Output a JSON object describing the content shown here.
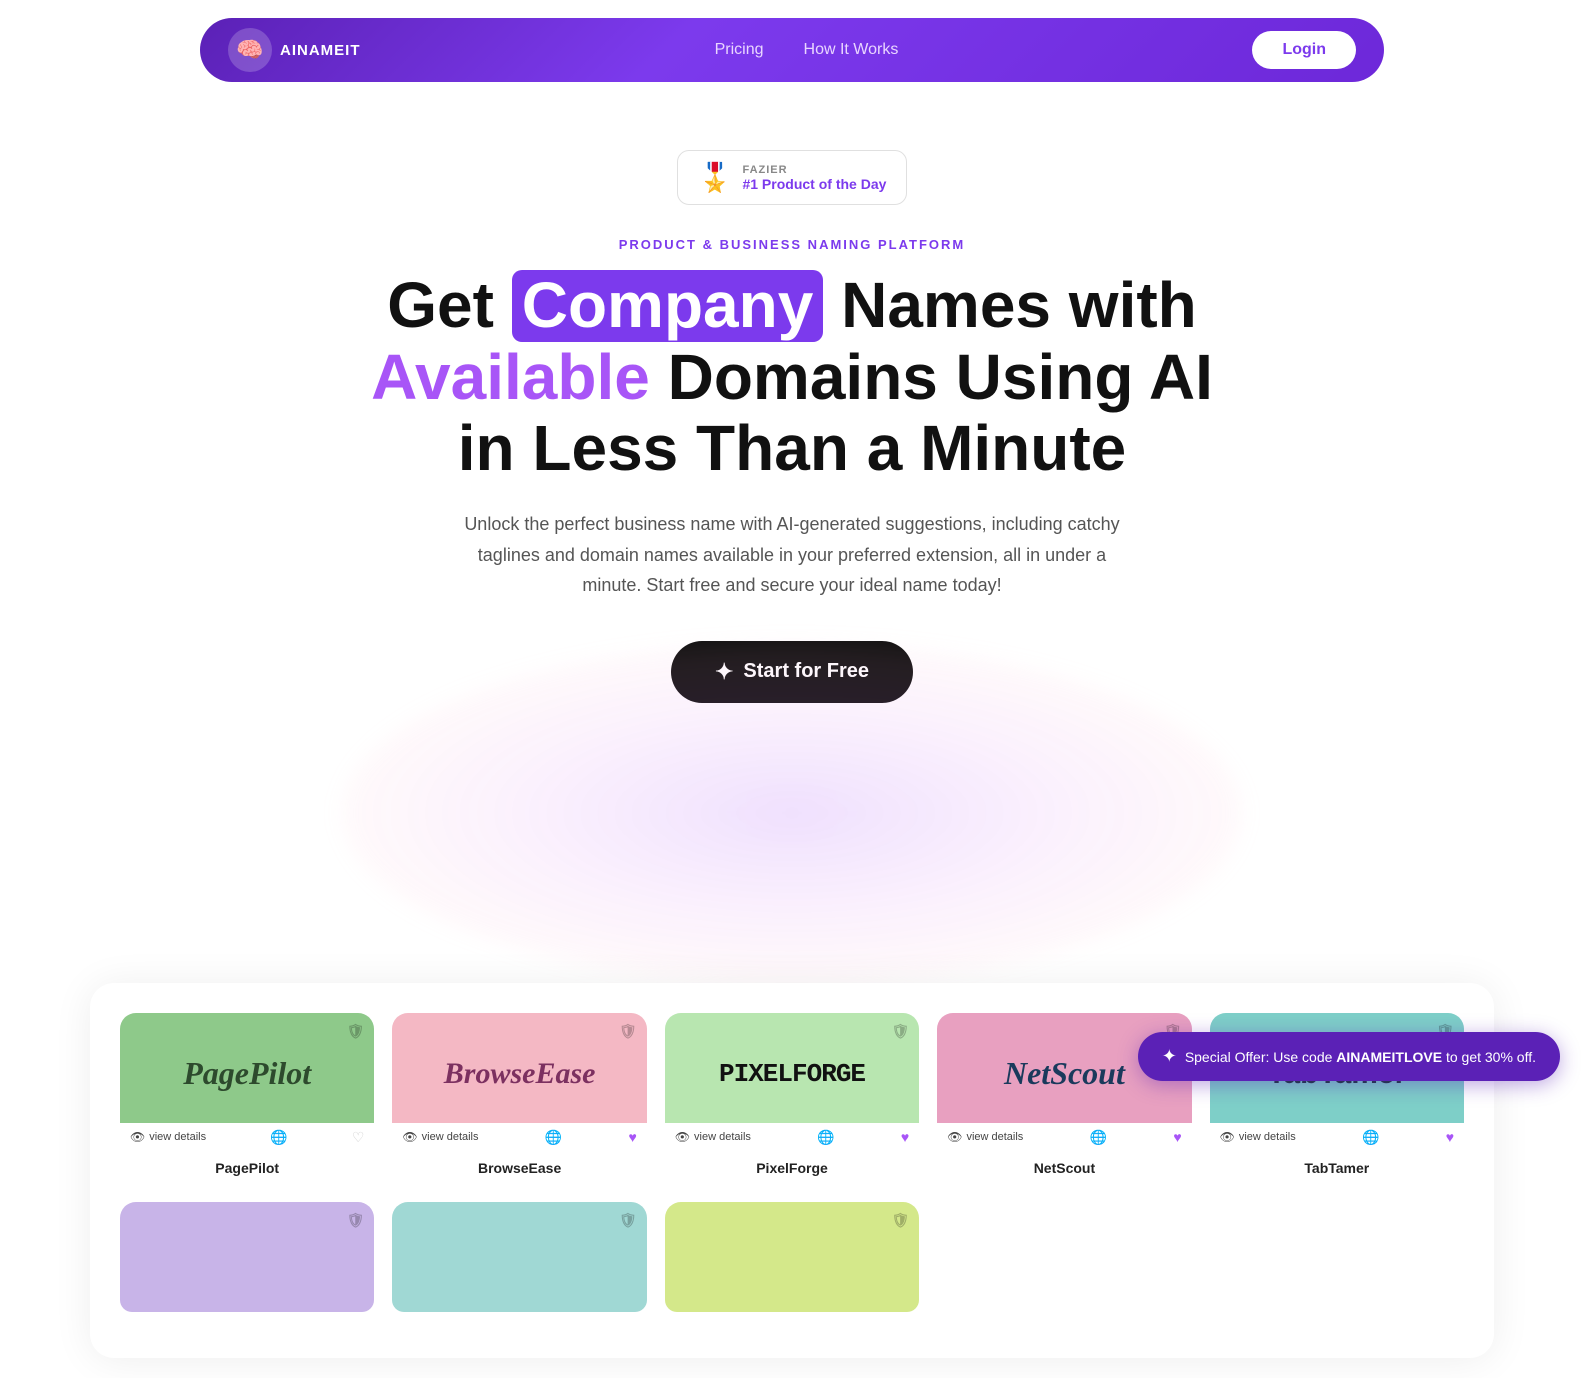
{
  "navbar": {
    "logo_icon": "🧠",
    "logo_text": "AINAMEIT",
    "nav_items": [
      {
        "label": "Pricing",
        "href": "#"
      },
      {
        "label": "How It Works",
        "href": "#"
      }
    ],
    "login_label": "Login"
  },
  "hero": {
    "badge": {
      "ribbon": "🎖️",
      "top_text": "FAZIER",
      "bottom_text": "#1 Product of the Day"
    },
    "subtitle": "PRODUCT & BUSINESS NAMING PLATFORM",
    "title_part1": "Get ",
    "title_highlight": "Company",
    "title_part2": " Names with",
    "title_line2_purple": "Available",
    "title_line2_rest": " Domains Using AI",
    "title_line3": "in Less Than a Minute",
    "description": "Unlock the perfect business name with AI-generated suggestions, including catchy taglines and domain names available in your preferred extension, all in under a minute. Start free and secure your ideal name today!",
    "cta_label": "Start for Free"
  },
  "cards": {
    "row1": [
      {
        "id": "pagepilot",
        "label": "PagePilot",
        "bg": "card-green",
        "name_class": "card-name-pagepilot",
        "heart": "empty"
      },
      {
        "id": "browseease",
        "label": "BrowseEase",
        "bg": "card-pink",
        "name_class": "card-name-browseease",
        "heart": "purple"
      },
      {
        "id": "pixelforge",
        "label": "PixelForge",
        "bg": "card-light-green",
        "name_class": "card-name-pixelforge",
        "heart": "purple"
      },
      {
        "id": "netscout",
        "label": "NetScout",
        "bg": "card-mauve",
        "name_class": "card-name-netscout",
        "heart": "purple"
      },
      {
        "id": "tabtamer",
        "label": "TabTamer",
        "bg": "card-teal",
        "name_class": "card-name-tabtamer",
        "heart": "purple"
      }
    ],
    "row2": [
      {
        "id": "partial1",
        "bg": "card-lavender"
      },
      {
        "id": "partial2",
        "bg": "card-light-teal"
      },
      {
        "id": "partial3",
        "bg": "card-yellow-green"
      }
    ],
    "view_details_label": "view details"
  },
  "special_offer": {
    "text_before": "Special Offer: Use code ",
    "code": "AINAMEITLOVE",
    "text_after": " to get 30% off."
  }
}
